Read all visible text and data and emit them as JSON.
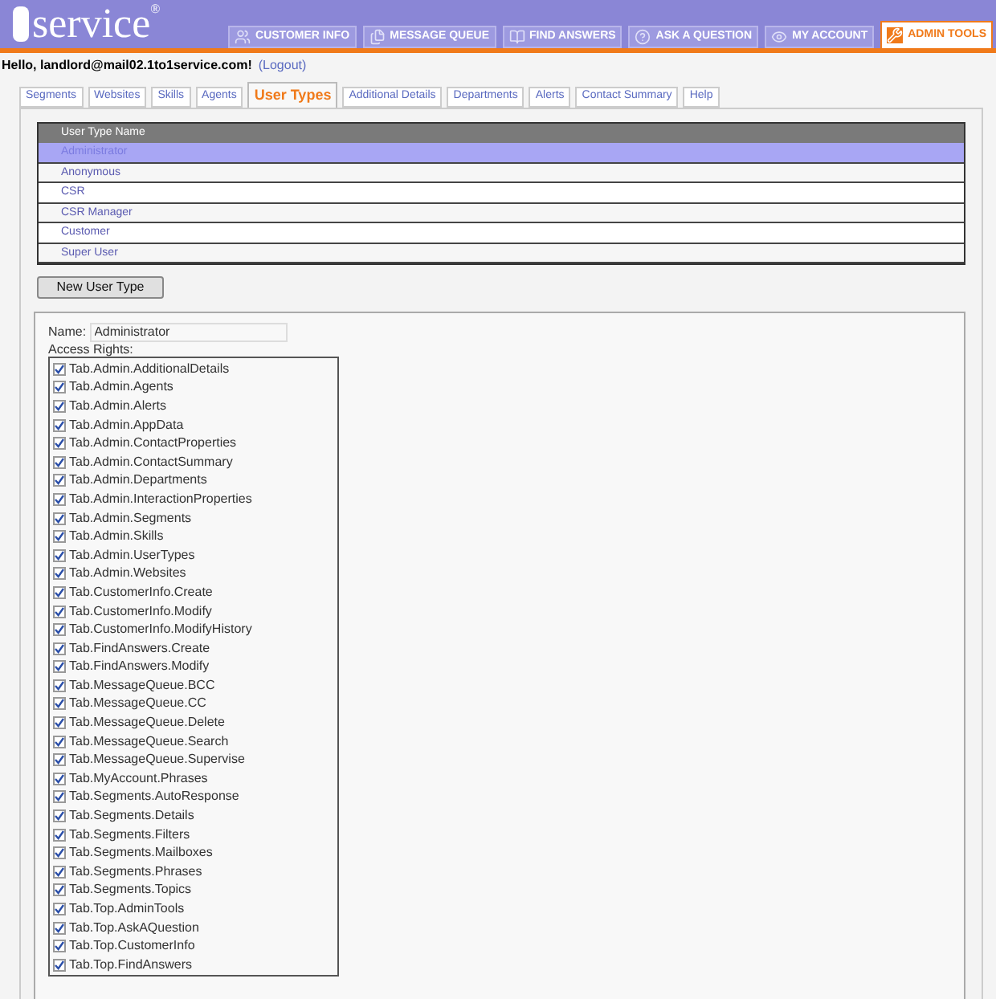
{
  "logo": {
    "text": "service",
    "mark": "®"
  },
  "nav": [
    {
      "label": "CUSTOMER INFO",
      "selected": false
    },
    {
      "label": "MESSAGE QUEUE",
      "selected": false
    },
    {
      "label": "FIND ANSWERS",
      "selected": false
    },
    {
      "label": "ASK A QUESTION",
      "selected": false
    },
    {
      "label": "MY ACCOUNT",
      "selected": false
    },
    {
      "label": "ADMIN TOOLS",
      "selected": true
    }
  ],
  "greeting": {
    "text": "Hello, landlord@mail02.1to1service.com!",
    "logout": "(Logout)"
  },
  "tabs": [
    {
      "label": "Segments",
      "selected": false
    },
    {
      "label": "Websites",
      "selected": false
    },
    {
      "label": "Skills",
      "selected": false
    },
    {
      "label": "Agents",
      "selected": false
    },
    {
      "label": "User Types",
      "selected": true
    },
    {
      "label": "Additional Details",
      "selected": false
    },
    {
      "label": "Departments",
      "selected": false
    },
    {
      "label": "Alerts",
      "selected": false
    },
    {
      "label": "Contact Summary",
      "selected": false
    },
    {
      "label": "Help",
      "selected": false
    }
  ],
  "table": {
    "columns": [
      "User Type Name"
    ],
    "rows": [
      {
        "name": "Administrator",
        "selected": true
      },
      {
        "name": "Anonymous",
        "selected": false
      },
      {
        "name": "CSR",
        "selected": false
      },
      {
        "name": "CSR Manager",
        "selected": false
      },
      {
        "name": "Customer",
        "selected": false
      },
      {
        "name": "Super User",
        "selected": false
      }
    ]
  },
  "new_button": "New User Type",
  "form": {
    "name_label": "Name:",
    "name_value": "Administrator",
    "rights_label": "Access Rights:",
    "rights": [
      {
        "label": "Tab.Admin.AdditionalDetails",
        "checked": true
      },
      {
        "label": "Tab.Admin.Agents",
        "checked": true
      },
      {
        "label": "Tab.Admin.Alerts",
        "checked": true
      },
      {
        "label": "Tab.Admin.AppData",
        "checked": true
      },
      {
        "label": "Tab.Admin.ContactProperties",
        "checked": true
      },
      {
        "label": "Tab.Admin.ContactSummary",
        "checked": true
      },
      {
        "label": "Tab.Admin.Departments",
        "checked": true
      },
      {
        "label": "Tab.Admin.InteractionProperties",
        "checked": true
      },
      {
        "label": "Tab.Admin.Segments",
        "checked": true
      },
      {
        "label": "Tab.Admin.Skills",
        "checked": true
      },
      {
        "label": "Tab.Admin.UserTypes",
        "checked": true
      },
      {
        "label": "Tab.Admin.Websites",
        "checked": true
      },
      {
        "label": "Tab.CustomerInfo.Create",
        "checked": true
      },
      {
        "label": "Tab.CustomerInfo.Modify",
        "checked": true
      },
      {
        "label": "Tab.CustomerInfo.ModifyHistory",
        "checked": true
      },
      {
        "label": "Tab.FindAnswers.Create",
        "checked": true
      },
      {
        "label": "Tab.FindAnswers.Modify",
        "checked": true
      },
      {
        "label": "Tab.MessageQueue.BCC",
        "checked": true
      },
      {
        "label": "Tab.MessageQueue.CC",
        "checked": true
      },
      {
        "label": "Tab.MessageQueue.Delete",
        "checked": true
      },
      {
        "label": "Tab.MessageQueue.Search",
        "checked": true
      },
      {
        "label": "Tab.MessageQueue.Supervise",
        "checked": true
      },
      {
        "label": "Tab.MyAccount.Phrases",
        "checked": true
      },
      {
        "label": "Tab.Segments.AutoResponse",
        "checked": true
      },
      {
        "label": "Tab.Segments.Details",
        "checked": true
      },
      {
        "label": "Tab.Segments.Filters",
        "checked": true
      },
      {
        "label": "Tab.Segments.Mailboxes",
        "checked": true
      },
      {
        "label": "Tab.Segments.Phrases",
        "checked": true
      },
      {
        "label": "Tab.Segments.Topics",
        "checked": true
      },
      {
        "label": "Tab.Top.AdminTools",
        "checked": true
      },
      {
        "label": "Tab.Top.AskAQuestion",
        "checked": true
      },
      {
        "label": "Tab.Top.CustomerInfo",
        "checked": true
      },
      {
        "label": "Tab.Top.FindAnswers",
        "checked": true
      }
    ]
  }
}
